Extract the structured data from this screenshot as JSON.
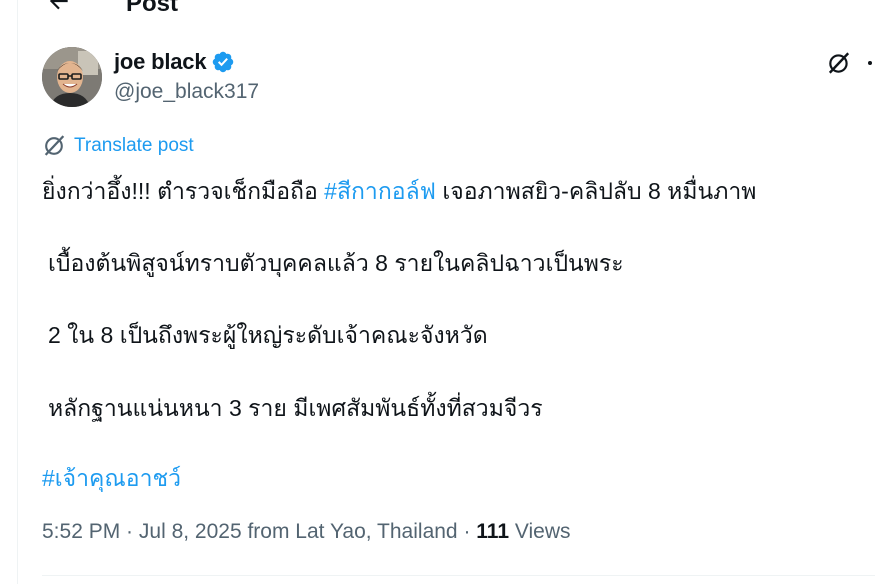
{
  "header": {
    "title": "Post"
  },
  "author": {
    "name": "joe black",
    "handle": "@joe_black317"
  },
  "translate": {
    "label": "Translate post"
  },
  "post": {
    "line1_before": "ยิ่งกว่าอึ้ง!!!  ตำรวจเช็กมือถือ ",
    "line1_hashtag": "#สีกากอล์ฟ",
    "line1_after": " เจอภาพสยิว-คลิปลับ 8 หมื่นภาพ",
    "line2": "เบื้องต้นพิสูจน์ทราบตัวบุคคลแล้ว 8 รายในคลิปฉาวเป็นพระ",
    "line3": "2 ใน 8 เป็นถึงพระผู้ใหญ่ระดับเจ้าคณะจังหวัด",
    "line4": "หลักฐานแน่นหนา 3 ราย มีเพศสัมพันธ์ทั้งที่สวมจีวร",
    "hashtag2": "#เจ้าคุณอาชว์"
  },
  "meta": {
    "time": "5:52 PM",
    "sep1": " · ",
    "date": "Jul 8, 2025",
    "location": " from Lat Yao, Thailand",
    "sep2": " · ",
    "views_count": "111",
    "views_label": " Views"
  },
  "colors": {
    "accent": "#1d9bf0",
    "text": "#0f1419",
    "secondary": "#536471"
  },
  "icons": {
    "back": "arrow-left-icon",
    "verified": "verified-badge-icon",
    "grok": "grok-icon",
    "more": "more-icon",
    "translate": "translate-icon"
  }
}
